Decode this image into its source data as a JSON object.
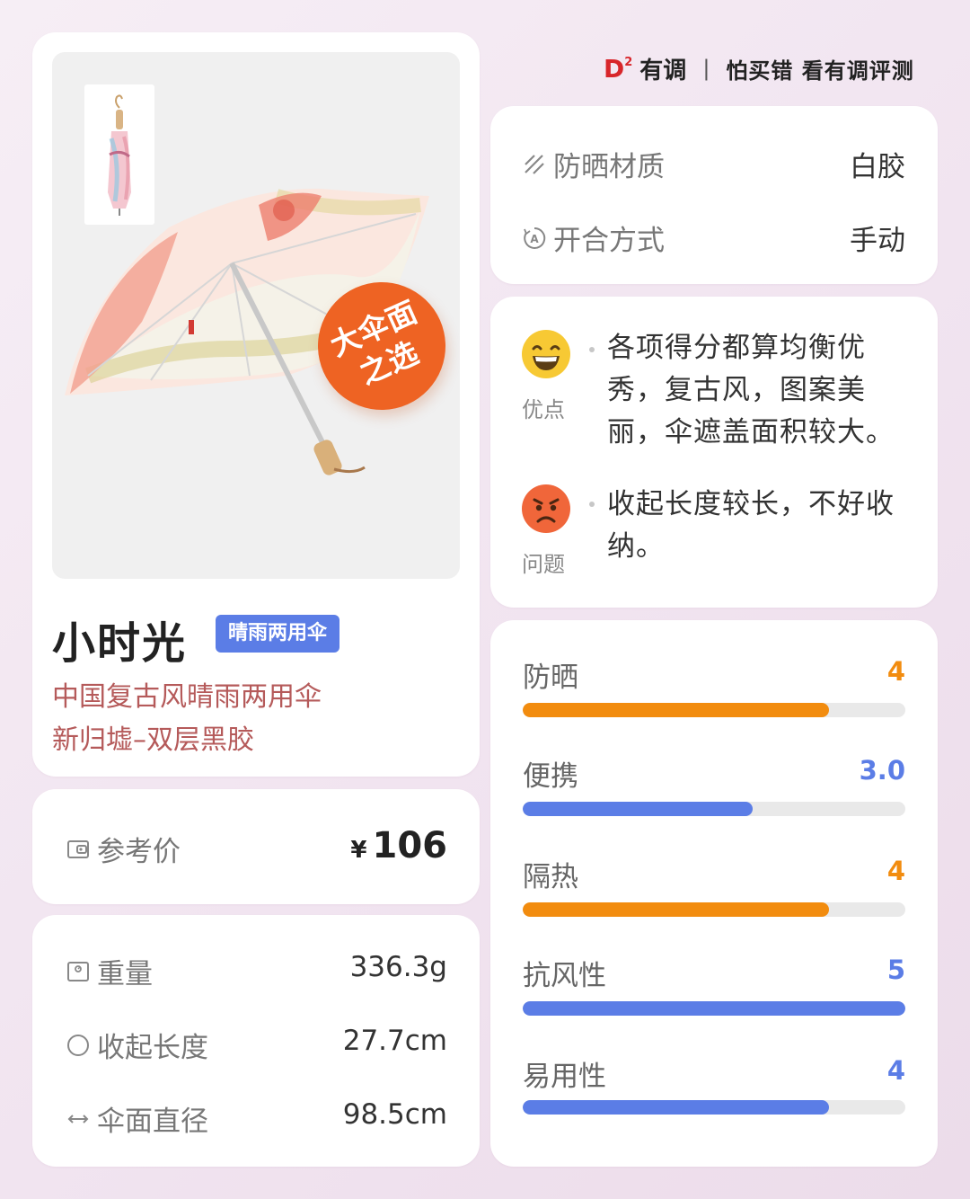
{
  "brand": {
    "logo_letter": "D",
    "logo_sup": "2",
    "name": "有调",
    "separator": "|",
    "slogan": "怕买错 看有调评测"
  },
  "product": {
    "badge_line1": "大伞面",
    "badge_line2": "之选",
    "title": "小时光",
    "tag": "晴雨两用伞",
    "subtitle_line1": "中国复古风晴雨两用伞",
    "subtitle_line2": "新归墟–双层黑胶"
  },
  "price": {
    "label": "参考价",
    "currency": "¥",
    "value": "106"
  },
  "specs": [
    {
      "label": "重量",
      "value": "336.3g",
      "icon": "scale-icon"
    },
    {
      "label": "收起长度",
      "value": "27.7cm",
      "icon": "circle-icon"
    },
    {
      "label": "伞面直径",
      "value": "98.5cm",
      "icon": "double-arrow-icon"
    }
  ],
  "material": [
    {
      "label": "防晒材质",
      "value": "白胶",
      "icon": "stripes-icon"
    },
    {
      "label": "开合方式",
      "value": "手动",
      "icon": "auto-a-icon"
    }
  ],
  "pros": {
    "caption": "优点",
    "text": "各项得分都算均衡优秀，复古风，图案美丽，伞遮盖面积较大。"
  },
  "cons": {
    "caption": "问题",
    "text": "收起长度较长，不好收纳。"
  },
  "scores": [
    {
      "label": "防晒",
      "value": "4",
      "fraction": 0.8,
      "color": "#f28c0f"
    },
    {
      "label": "便携",
      "value": "3.0",
      "fraction": 0.6,
      "color": "#5b7de6"
    },
    {
      "label": "隔热",
      "value": "4",
      "fraction": 0.8,
      "color": "#f28c0f"
    },
    {
      "label": "抗风性",
      "value": "5",
      "fraction": 1.0,
      "color": "#5b7de6"
    },
    {
      "label": "易用性",
      "value": "4",
      "fraction": 0.8,
      "color": "#5b7de6"
    }
  ]
}
